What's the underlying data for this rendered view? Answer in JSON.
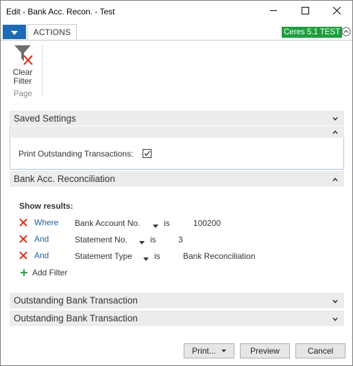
{
  "window": {
    "title": "Edit - Bank Acc. Recon. - Test",
    "controls": [
      "minimize-icon",
      "maximize-icon",
      "close-icon"
    ]
  },
  "ribbon": {
    "tab_label": "ACTIONS",
    "environment_badge": "Ceres 5.1 TEST",
    "clear_filter_line1": "Clear",
    "clear_filter_line2": "Filter",
    "group_label": "Page"
  },
  "saved_settings": {
    "header": "Saved Settings",
    "print_outstanding_label": "Print Outstanding Transactions:",
    "print_outstanding_checked": true
  },
  "reconciliation": {
    "header": "Bank Acc. Reconciliation",
    "show_results_label": "Show results:",
    "filters": [
      {
        "connector": "Where",
        "field": "Bank Account No.",
        "operator": "is",
        "value": "100200"
      },
      {
        "connector": "And",
        "field": "Statement No.",
        "operator": "is",
        "value": "3"
      },
      {
        "connector": "And",
        "field": "Statement Type",
        "operator": "is",
        "value": "Bank Reconciliation"
      }
    ],
    "add_filter_label": "Add Filter"
  },
  "sections": [
    {
      "header": "Outstanding Bank Transaction"
    },
    {
      "header": "Outstanding Bank Transaction"
    }
  ],
  "footer": {
    "print_label": "Print...",
    "preview_label": "Preview",
    "cancel_label": "Cancel"
  },
  "colors": {
    "accent": "#1e6ab4",
    "badge": "#1e9e3e",
    "link": "#1f5ea8",
    "remove": "#d9341f"
  }
}
